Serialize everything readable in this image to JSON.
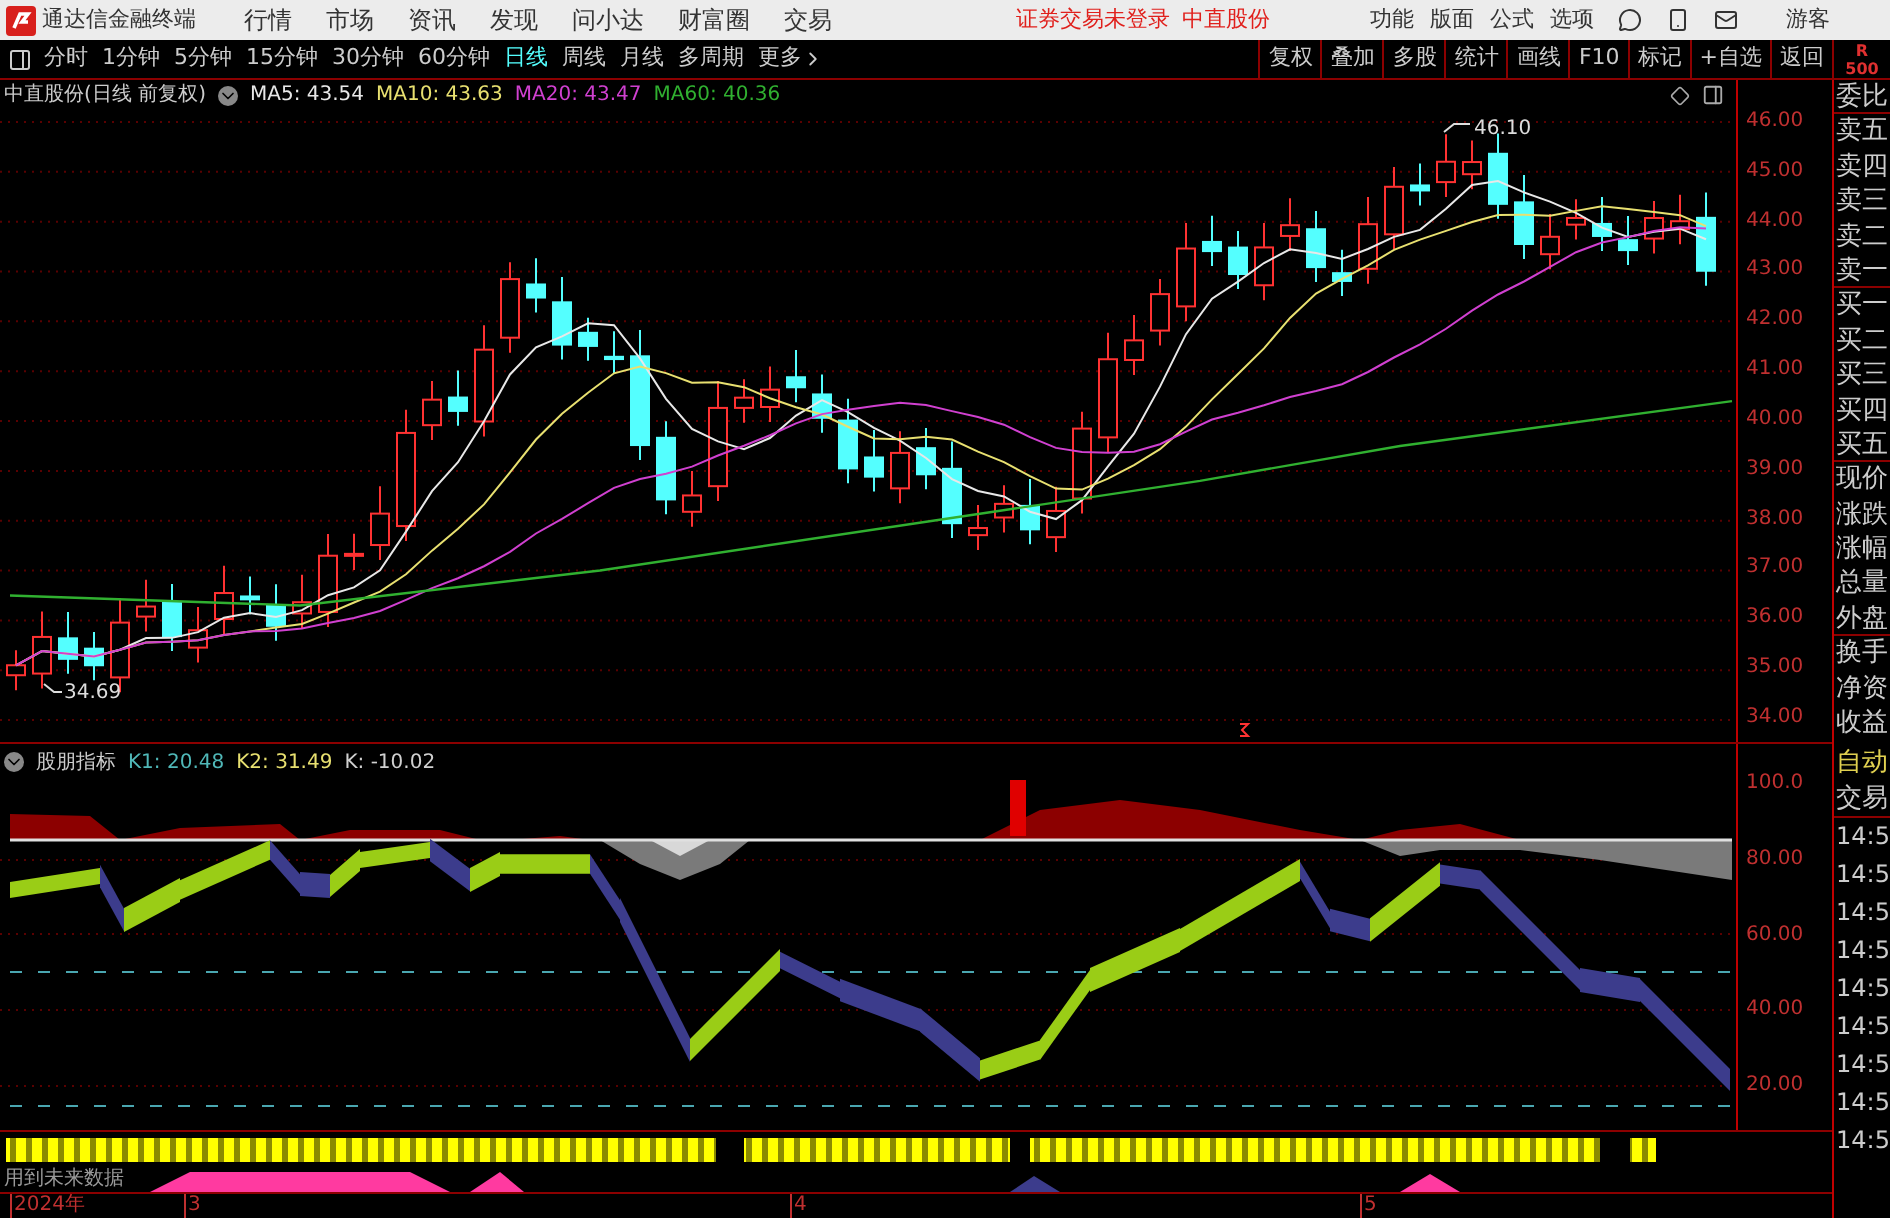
{
  "title_bar": {
    "app_name": "通达信金融终端",
    "menu": [
      "行情",
      "市场",
      "资讯",
      "发现",
      "问小达",
      "财富圈",
      "交易"
    ],
    "login_status": "证券交易未登录",
    "stock_name": "中直股份",
    "tools": [
      "功能",
      "版面",
      "公式",
      "选项"
    ],
    "user": "游客"
  },
  "toolbar": {
    "periods": [
      {
        "label": "分时",
        "selected": false
      },
      {
        "label": "1分钟",
        "selected": false
      },
      {
        "label": "5分钟",
        "selected": false
      },
      {
        "label": "15分钟",
        "selected": false
      },
      {
        "label": "30分钟",
        "selected": false
      },
      {
        "label": "60分钟",
        "selected": false
      },
      {
        "label": "日线",
        "selected": true
      },
      {
        "label": "周线",
        "selected": false
      },
      {
        "label": "月线",
        "selected": false
      },
      {
        "label": "多周期",
        "selected": false
      }
    ],
    "more": "更多",
    "actions": [
      "复权",
      "叠加",
      "多股",
      "统计",
      "画线",
      "F10",
      "标记",
      "+自选",
      "返回"
    ],
    "corner": [
      "R",
      "500"
    ]
  },
  "price_chart": {
    "title": "中直股份(日线 前复权)",
    "moving_averages": [
      {
        "label": "MA5: 43.54",
        "color": "#e8e8e8"
      },
      {
        "label": "MA10: 43.63",
        "color": "#e8e070"
      },
      {
        "label": "MA20: 43.47",
        "color": "#d040d0"
      },
      {
        "label": "MA60: 40.36",
        "color": "#30b030"
      }
    ],
    "high_label": "46.10",
    "low_label": "34.69",
    "axis": [
      "46.00",
      "45.00",
      "44.00",
      "43.00",
      "42.00",
      "41.00",
      "40.00",
      "39.00",
      "38.00",
      "37.00",
      "36.00",
      "35.00",
      "34.00"
    ]
  },
  "indicator": {
    "name": "股朋指标",
    "values": [
      {
        "label": "K1: 20.48",
        "color": "#50b8b8"
      },
      {
        "label": "K2: 31.49",
        "color": "#e8e070"
      },
      {
        "label": "K: -10.02",
        "color": "#d0d0d0"
      }
    ],
    "axis": [
      "100.0",
      "80.00",
      "60.00",
      "40.00",
      "20.00"
    ],
    "warning": "用到未来数据"
  },
  "side_panel": {
    "quote_labels": [
      "委比",
      "卖五",
      "卖四",
      "卖三",
      "卖二",
      "卖一",
      "买一",
      "买二",
      "买三",
      "买四",
      "买五",
      "现价",
      "涨跌",
      "涨幅",
      "总量",
      "外盘",
      "换手",
      "净资",
      "收益"
    ],
    "auto": "自动",
    "trade": "交易",
    "times": [
      "14:5",
      "14:5",
      "14:5",
      "14:5",
      "14:5",
      "14:5",
      "14:5",
      "14:5",
      "14:5"
    ]
  },
  "date_axis": [
    "2024年",
    "3",
    "4",
    "5"
  ]
}
